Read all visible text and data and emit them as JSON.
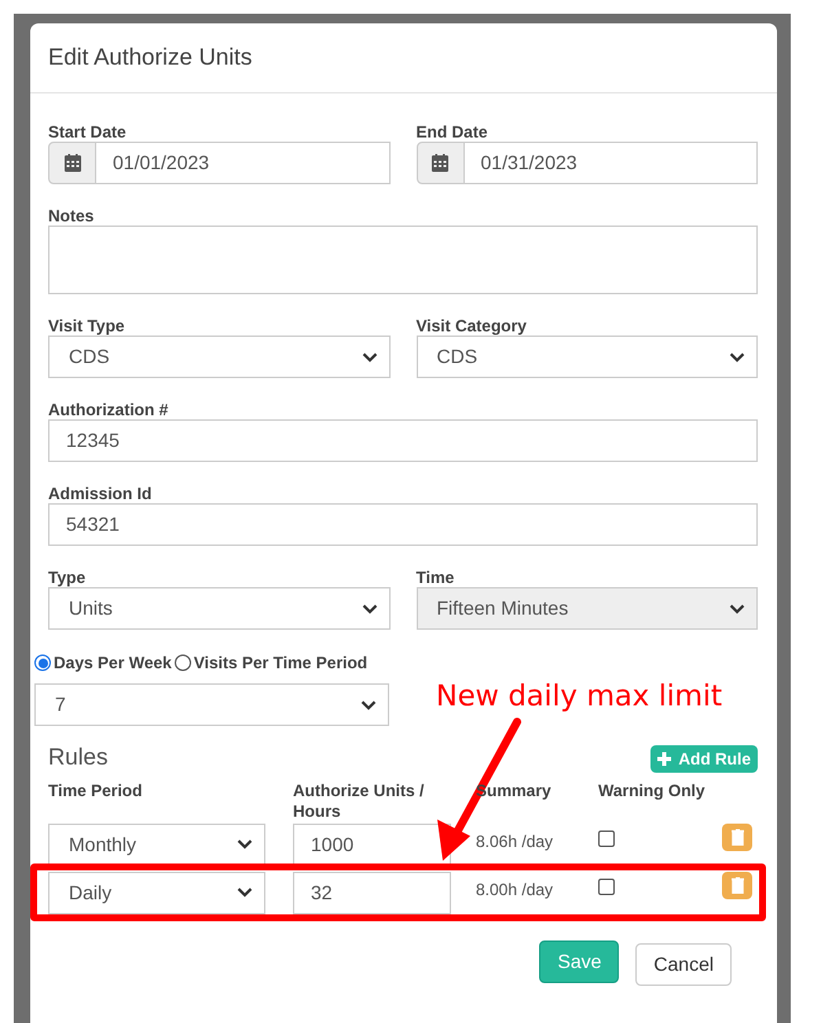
{
  "dialog": {
    "title": "Edit Authorize Units"
  },
  "form_rows": [
    [
      {
        "kind": "date",
        "label": "Start Date",
        "value": "01/01/2023"
      },
      {
        "kind": "date",
        "label": "End Date",
        "value": "01/31/2023"
      }
    ],
    [
      {
        "kind": "textarea",
        "label": "Notes"
      }
    ],
    [
      {
        "kind": "select",
        "label": "Visit Type",
        "value": "CDS",
        "disabled": false
      },
      {
        "kind": "select",
        "label": "Visit Category",
        "value": "CDS",
        "disabled": false
      }
    ],
    [
      {
        "kind": "text",
        "label": "Authorization #",
        "value": "12345"
      }
    ],
    [
      {
        "kind": "text",
        "label": "Admission Id",
        "value": "54321"
      }
    ],
    [
      {
        "kind": "select",
        "label": "Type",
        "value": "Units",
        "disabled": false
      },
      {
        "kind": "select",
        "label": "Time",
        "value": "Fifteen Minutes",
        "disabled": true
      }
    ]
  ],
  "frequency_options": [
    {
      "label": "Days Per Week",
      "selected": true
    },
    {
      "label": "Visits Per Time Period",
      "selected": false
    }
  ],
  "frequency_value": "7",
  "rules": {
    "title": "Rules",
    "add_button": "Add Rule",
    "columns": [
      "Time Period",
      "Authorize Units / Hours",
      "Summary",
      "Warning Only"
    ],
    "rows": [
      {
        "period": "Monthly",
        "units": "1000",
        "summary": "8.06h /day",
        "warning_only": false
      },
      {
        "period": "Daily",
        "units": "32",
        "summary": "8.00h /day",
        "warning_only": false
      }
    ]
  },
  "annotation": {
    "text": "New daily max limit"
  },
  "buttons": {
    "save": "Save",
    "cancel": "Cancel"
  }
}
